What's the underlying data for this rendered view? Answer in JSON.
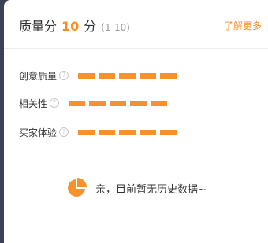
{
  "header": {
    "label": "质量分",
    "score": "10",
    "unit": "分",
    "range": "(1-10)",
    "learn_more": "了解更多"
  },
  "metrics": [
    {
      "label": "创意质量",
      "level": 5,
      "max": 5
    },
    {
      "label": "相关性",
      "level": 5,
      "max": 5
    },
    {
      "label": "买家体验",
      "level": 5,
      "max": 5
    }
  ],
  "help_icon_glyph": "?",
  "empty_state": {
    "icon": "pie-chart-icon",
    "text": "亲，目前暂无历史数据~"
  },
  "colors": {
    "accent": "#ff8c1a",
    "bar": "#f7912c",
    "text": "#333333",
    "muted": "#999999",
    "sidebar": "#3b4256"
  }
}
